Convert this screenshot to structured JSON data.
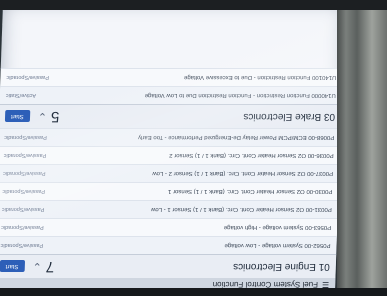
{
  "statusbar": {
    "title": "Fuel System Control Function"
  },
  "groups": [
    {
      "name": "01 Engine Electronics",
      "count": "7",
      "button": "Start",
      "rows": [
        {
          "desc": "P0562-00 System voltage - Low voltage",
          "status": "Passive/Sporadic"
        },
        {
          "desc": "P0563-00 System voltage - High voltage",
          "status": "Passive/Sporadic"
        },
        {
          "desc": "P0031-00 O2 Sensor Heater Cont. Circ. (Bank 1 / 1) Sensor 1 - Low",
          "status": "Passive/Sporadic"
        },
        {
          "desc": "P0030-00 O2 Sensor Heater Cont. Circ. (Bank 1 / 1) Sensor 1",
          "status": "Passive/Sporadic"
        },
        {
          "desc": "P0037-00 O2 Sensor Heater Cont. Circ. (Bank 1 / 1) Sensor 2 - Low",
          "status": "Passive/Sporadic"
        },
        {
          "desc": "P0036-00 O2 Sensor Heater Cont. Circ. (Bank 1 / 1) Sensor 2",
          "status": "Passive/Sporadic"
        },
        {
          "desc": "P0068-00 ECM/PCM Power Relay De-Energized Performance - Too Early",
          "status": "Passive/Sporadic"
        }
      ]
    },
    {
      "name": "03 Brake Electronics",
      "count": "5",
      "button": "Start",
      "rows": [
        {
          "desc": "U140000 Function Restriction - Function Restriction Due to Low Voltage",
          "status": "Active/Static"
        },
        {
          "desc": "U140100 Function Restriction - Due to Excessive Voltage",
          "status": "Passive/Sporadic"
        }
      ]
    }
  ]
}
